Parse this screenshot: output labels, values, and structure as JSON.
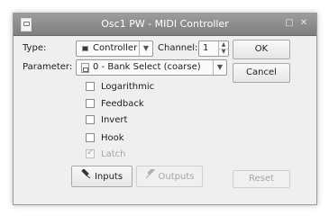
{
  "window": {
    "title": "Osc1 PW - MIDI Controller",
    "restore_glyph": "□",
    "close_glyph": "✕"
  },
  "type_row": {
    "label": "Type:",
    "value": "Controller",
    "channel_label": "Channel:",
    "channel_value": "1"
  },
  "parameter_row": {
    "label": "Parameter:",
    "value": "0 - Bank Select (coarse)"
  },
  "options": [
    {
      "label": "Logarithmic",
      "checked": false,
      "enabled": true
    },
    {
      "label": "Feedback",
      "checked": false,
      "enabled": true
    },
    {
      "label": "Invert",
      "checked": false,
      "enabled": true
    },
    {
      "label": "Hook",
      "checked": false,
      "enabled": true
    },
    {
      "label": "Latch",
      "checked": true,
      "enabled": false
    }
  ],
  "buttons": {
    "ok": "OK",
    "cancel": "Cancel",
    "inputs": "Inputs",
    "outputs": "Outputs",
    "reset": "Reset"
  },
  "icons": {
    "app": "midi-controller-icon",
    "controller": "controller-icon",
    "parameter": "document-icon",
    "inputs": "plug-in-icon",
    "outputs": "plug-out-icon"
  }
}
